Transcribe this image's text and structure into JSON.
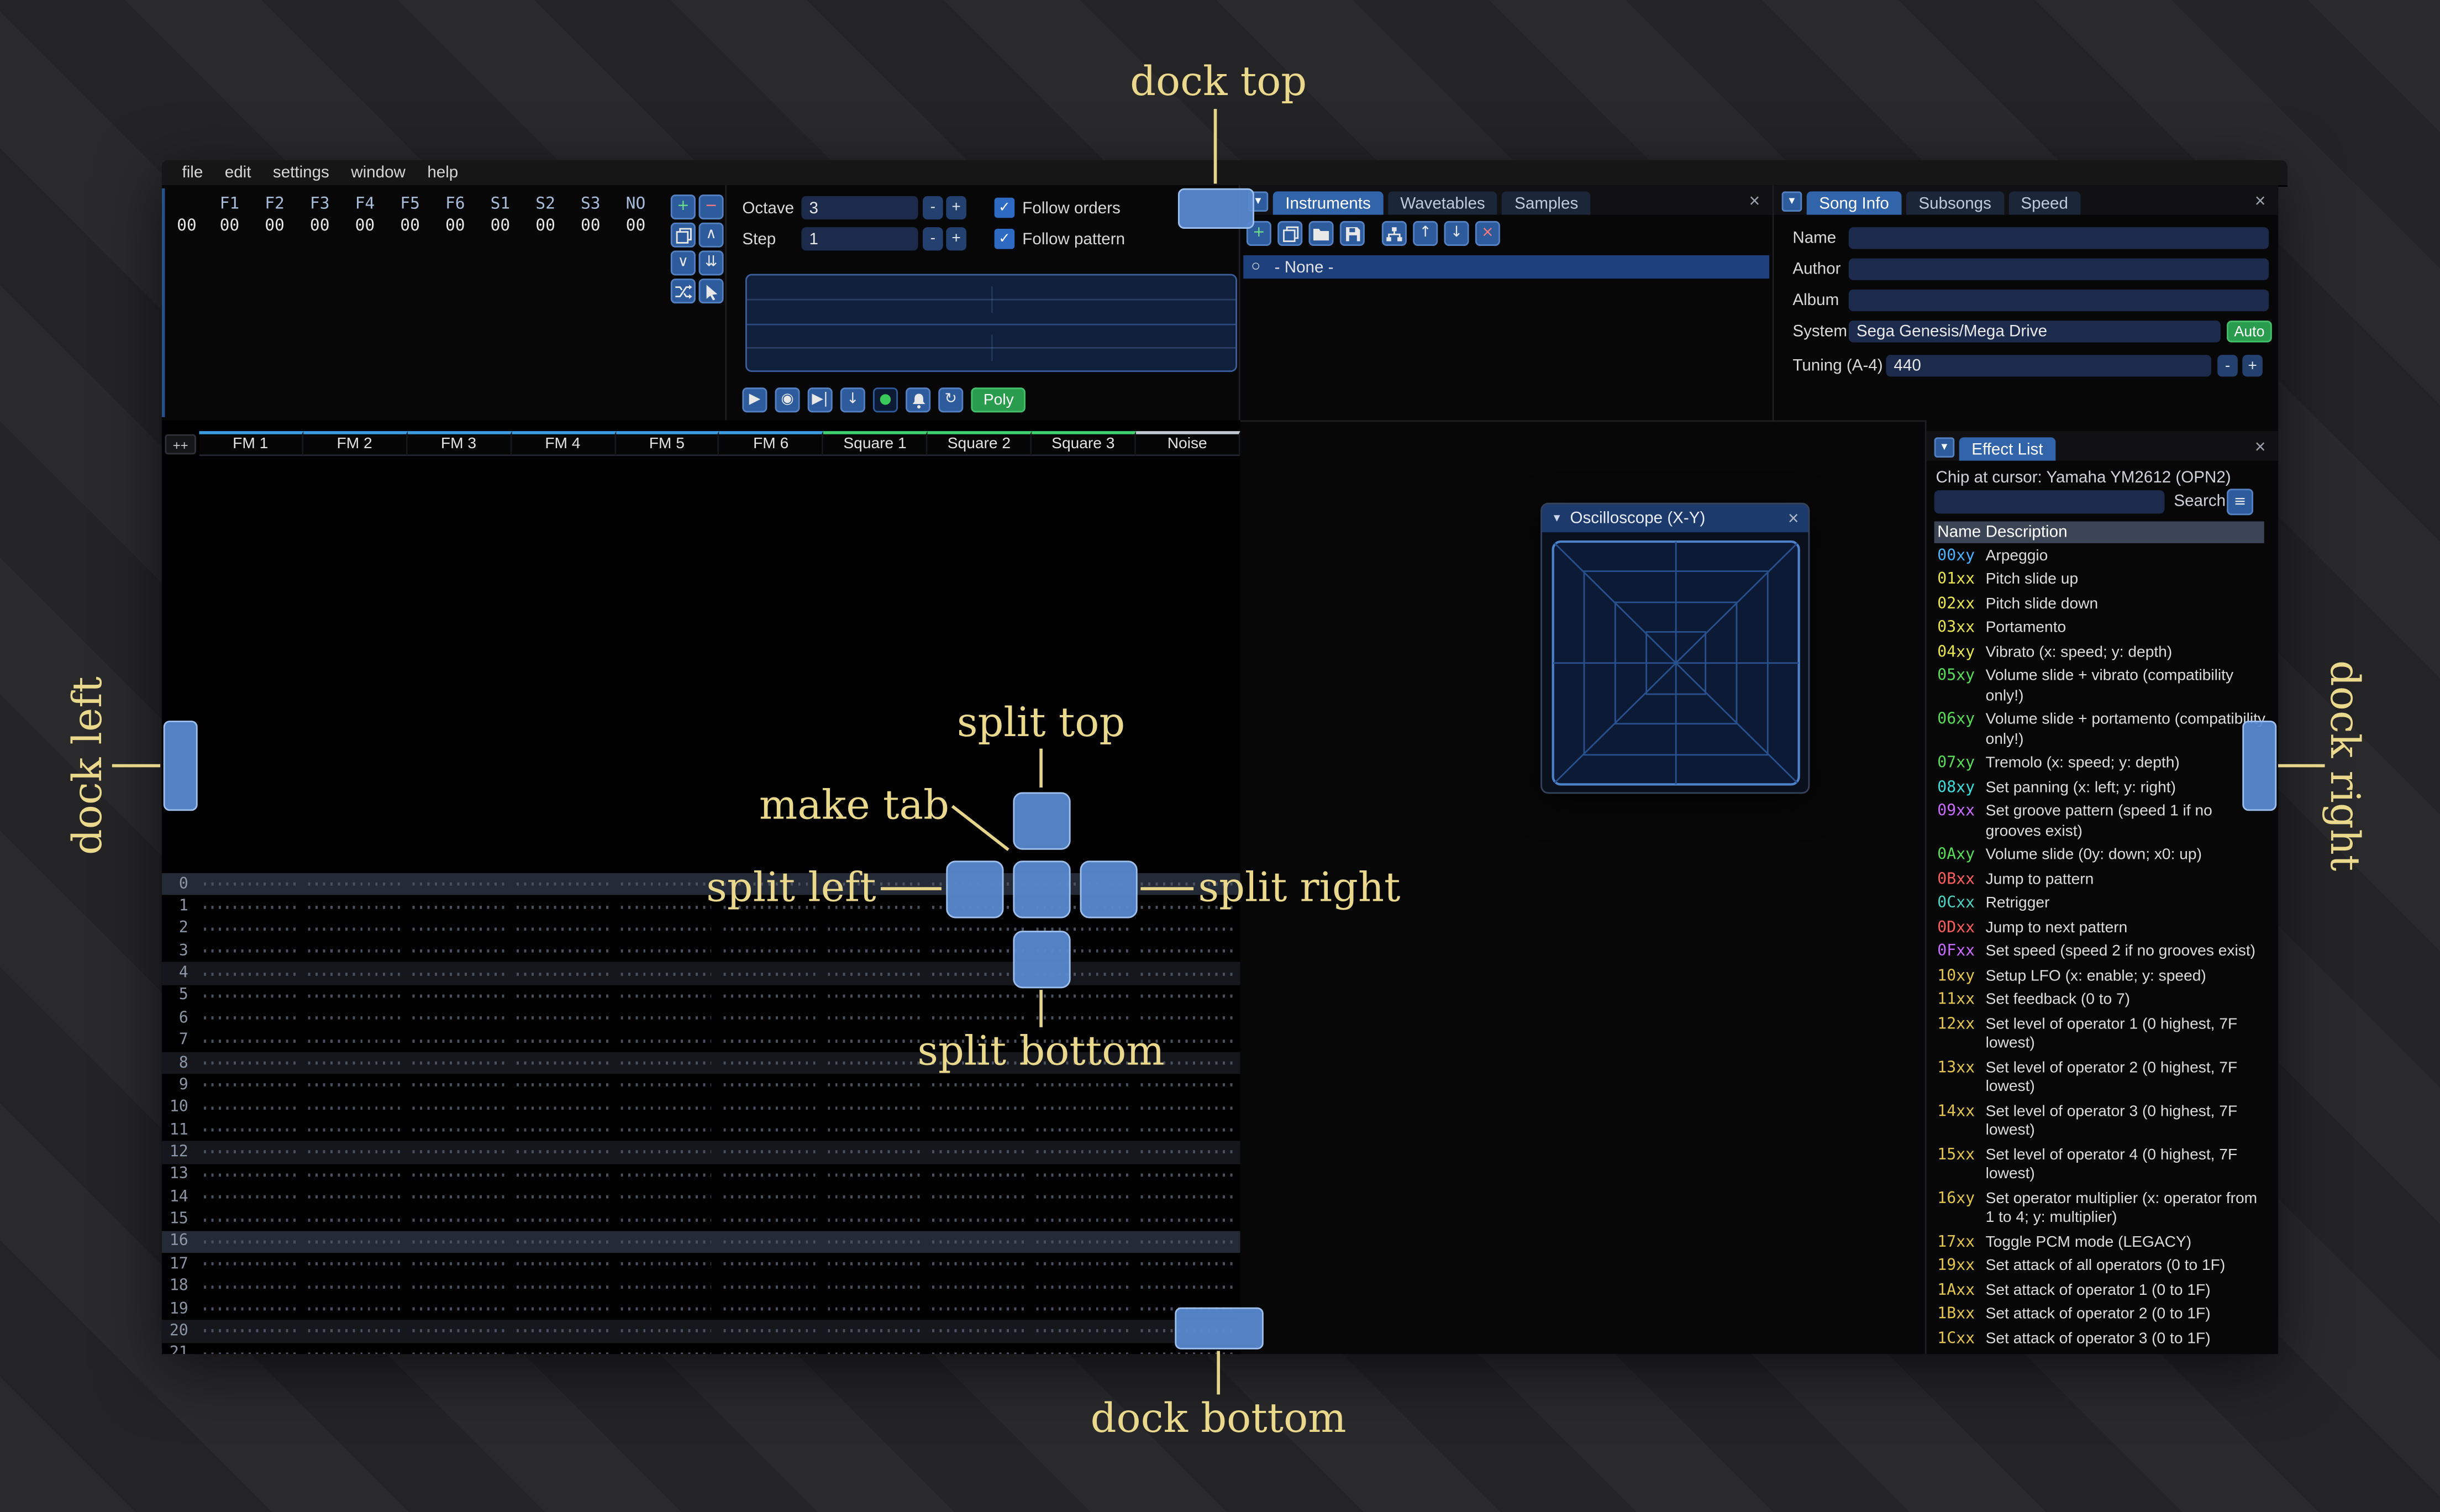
{
  "ui": {
    "collapse_glyph": "▼",
    "close_glyph": "×",
    "radio_glyph": "○",
    "check_glyph": "✓",
    "menu_glyph": "≡"
  },
  "menu": {
    "items": [
      "file",
      "edit",
      "settings",
      "window",
      "help"
    ]
  },
  "orders": {
    "columns": [
      "F1",
      "F2",
      "F3",
      "F4",
      "F5",
      "F6",
      "S1",
      "S2",
      "S3",
      "NO"
    ],
    "row_label": "00",
    "row_values": [
      "00",
      "00",
      "00",
      "00",
      "00",
      "00",
      "00",
      "00",
      "00",
      "00"
    ],
    "buttons": [
      {
        "name": "order-add-button",
        "glyph": "+",
        "color": "green"
      },
      {
        "name": "order-remove-button",
        "glyph": "−",
        "color": "red"
      },
      {
        "name": "order-duplicate-button",
        "icon": "copy"
      },
      {
        "name": "order-move-up-button",
        "glyph": "∧"
      },
      {
        "name": "order-move-down-button",
        "glyph": "∨"
      },
      {
        "name": "order-duplicate-end-button",
        "glyph": "⇊"
      },
      {
        "name": "order-change-all-button",
        "icon": "swap"
      },
      {
        "name": "order-edit-mode-button",
        "icon": "pointer"
      }
    ]
  },
  "edit_controls": {
    "octave_label": "Octave",
    "octave_value": "3",
    "step_label": "Step",
    "step_value": "1",
    "minus_label": "-",
    "plus_label": "+",
    "follow_orders_label": "Follow orders",
    "follow_pattern_label": "Follow pattern"
  },
  "transport": {
    "buttons": [
      {
        "name": "play-button",
        "glyph": "▶",
        "variant": "blue"
      },
      {
        "name": "stop-button",
        "glyph": "◉",
        "variant": "blue"
      },
      {
        "name": "play-from-cursor-button",
        "glyph": "▶|",
        "variant": "blue"
      },
      {
        "name": "step-row-button",
        "glyph": "↓",
        "variant": "blue"
      },
      {
        "name": "record-button",
        "glyph": "●",
        "variant": "record"
      },
      {
        "name": "metronome-button",
        "icon": "bell",
        "variant": "blue"
      },
      {
        "name": "repeat-button",
        "glyph": "↻",
        "variant": "blue"
      },
      {
        "name": "poly-button",
        "label": "Poly",
        "variant": "green"
      }
    ]
  },
  "instruments_panel": {
    "tabs": [
      "Instruments",
      "Wavetables",
      "Samples"
    ],
    "toolbar": [
      {
        "name": "instrument-add-button",
        "glyph": "+",
        "color": "green"
      },
      {
        "name": "instrument-duplicate-button",
        "icon": "copy"
      },
      {
        "name": "instrument-open-button",
        "icon": "folder"
      },
      {
        "name": "instrument-save-button",
        "icon": "floppy"
      },
      {
        "name": "instrument-organize-button",
        "icon": "branch",
        "gap": true
      },
      {
        "name": "instrument-move-up-button",
        "glyph": "↑"
      },
      {
        "name": "instrument-move-down-button",
        "glyph": "↓"
      },
      {
        "name": "instrument-delete-button",
        "glyph": "×",
        "color": "red"
      }
    ],
    "list": [
      {
        "label": "- None -",
        "selected": true
      }
    ]
  },
  "song_info": {
    "tabs": [
      "Song Info",
      "Subsongs",
      "Speed"
    ],
    "fields": [
      {
        "label": "Name",
        "value": ""
      },
      {
        "label": "Author",
        "value": ""
      },
      {
        "label": "Album",
        "value": ""
      }
    ],
    "system_label": "System",
    "system_value": "Sega Genesis/Mega Drive",
    "auto_label": "Auto",
    "tuning_label": "Tuning (A-4)",
    "tuning_value": "440",
    "minus_label": "-",
    "plus_label": "+"
  },
  "pattern": {
    "expand_label": "++",
    "visible_rows": 22,
    "channels": [
      {
        "label": "FM 1",
        "type": "fm"
      },
      {
        "label": "FM 2",
        "type": "fm"
      },
      {
        "label": "FM 3",
        "type": "fm"
      },
      {
        "label": "FM 4",
        "type": "fm"
      },
      {
        "label": "FM 5",
        "type": "fm"
      },
      {
        "label": "FM 6",
        "type": "fm"
      },
      {
        "label": "Square 1",
        "type": "square"
      },
      {
        "label": "Square 2",
        "type": "square"
      },
      {
        "label": "Square 3",
        "type": "square"
      },
      {
        "label": "Noise",
        "type": "noise"
      }
    ]
  },
  "oscilloscope": {
    "title": "Oscilloscope (X-Y)"
  },
  "effect_list": {
    "title": "Effect List",
    "chip_line": "Chip at cursor: Yamaha YM2612 (OPN2)",
    "search_label": "Search",
    "search_value": "",
    "header_name": "Name",
    "header_desc": "Description",
    "colors": {
      "primary": "#4ab2ff",
      "pitch": "#e8e44e",
      "volume": "#58dc58",
      "panning": "#3cdcdc",
      "speed": "#c86aff",
      "song": "#ff5c5c",
      "secondary": "#4ad2c2",
      "chip": "#e3c44c"
    },
    "effects": [
      {
        "code": "00xy",
        "type": "primary",
        "desc": "Arpeggio"
      },
      {
        "code": "01xx",
        "type": "pitch",
        "desc": "Pitch slide up"
      },
      {
        "code": "02xx",
        "type": "pitch",
        "desc": "Pitch slide down"
      },
      {
        "code": "03xx",
        "type": "pitch",
        "desc": "Portamento"
      },
      {
        "code": "04xy",
        "type": "pitch",
        "desc": "Vibrato (x: speed; y: depth)"
      },
      {
        "code": "05xy",
        "type": "volume",
        "desc": "Volume slide + vibrato (compatibility only!)"
      },
      {
        "code": "06xy",
        "type": "volume",
        "desc": "Volume slide + portamento (compatibility only!)"
      },
      {
        "code": "07xy",
        "type": "volume",
        "desc": "Tremolo (x: speed; y: depth)"
      },
      {
        "code": "08xy",
        "type": "panning",
        "desc": "Set panning (x: left; y: right)"
      },
      {
        "code": "09xx",
        "type": "speed",
        "desc": "Set groove pattern (speed 1 if no grooves exist)"
      },
      {
        "code": "0Axy",
        "type": "volume",
        "desc": "Volume slide (0y: down; x0: up)"
      },
      {
        "code": "0Bxx",
        "type": "song",
        "desc": "Jump to pattern"
      },
      {
        "code": "0Cxx",
        "type": "secondary",
        "desc": "Retrigger"
      },
      {
        "code": "0Dxx",
        "type": "song",
        "desc": "Jump to next pattern"
      },
      {
        "code": "0Fxx",
        "type": "speed",
        "desc": "Set speed (speed 2 if no grooves exist)"
      },
      {
        "code": "10xy",
        "type": "chip",
        "desc": "Setup LFO (x: enable; y: speed)"
      },
      {
        "code": "11xx",
        "type": "chip",
        "desc": "Set feedback (0 to 7)"
      },
      {
        "code": "12xx",
        "type": "chip",
        "desc": "Set level of operator 1 (0 highest, 7F lowest)"
      },
      {
        "code": "13xx",
        "type": "chip",
        "desc": "Set level of operator 2 (0 highest, 7F lowest)"
      },
      {
        "code": "14xx",
        "type": "chip",
        "desc": "Set level of operator 3 (0 highest, 7F lowest)"
      },
      {
        "code": "15xx",
        "type": "chip",
        "desc": "Set level of operator 4 (0 highest, 7F lowest)"
      },
      {
        "code": "16xy",
        "type": "chip",
        "desc": "Set operator multiplier (x: operator from 1 to 4; y: multiplier)"
      },
      {
        "code": "17xx",
        "type": "chip",
        "desc": "Toggle PCM mode (LEGACY)"
      },
      {
        "code": "19xx",
        "type": "chip",
        "desc": "Set attack of all operators (0 to 1F)"
      },
      {
        "code": "1Axx",
        "type": "chip",
        "desc": "Set attack of operator 1 (0 to 1F)"
      },
      {
        "code": "1Bxx",
        "type": "chip",
        "desc": "Set attack of operator 2 (0 to 1F)"
      },
      {
        "code": "1Cxx",
        "type": "chip",
        "desc": "Set attack of operator 3 (0 to 1F)"
      }
    ]
  },
  "overlay": {
    "labels": {
      "dock_top": "dock top",
      "dock_left": "dock left",
      "dock_right": "dock right",
      "dock_bottom": "dock bottom",
      "split_top": "split top",
      "split_left": "split left",
      "split_right": "split right",
      "split_bottom": "split bottom",
      "make_tab": "make tab"
    }
  }
}
